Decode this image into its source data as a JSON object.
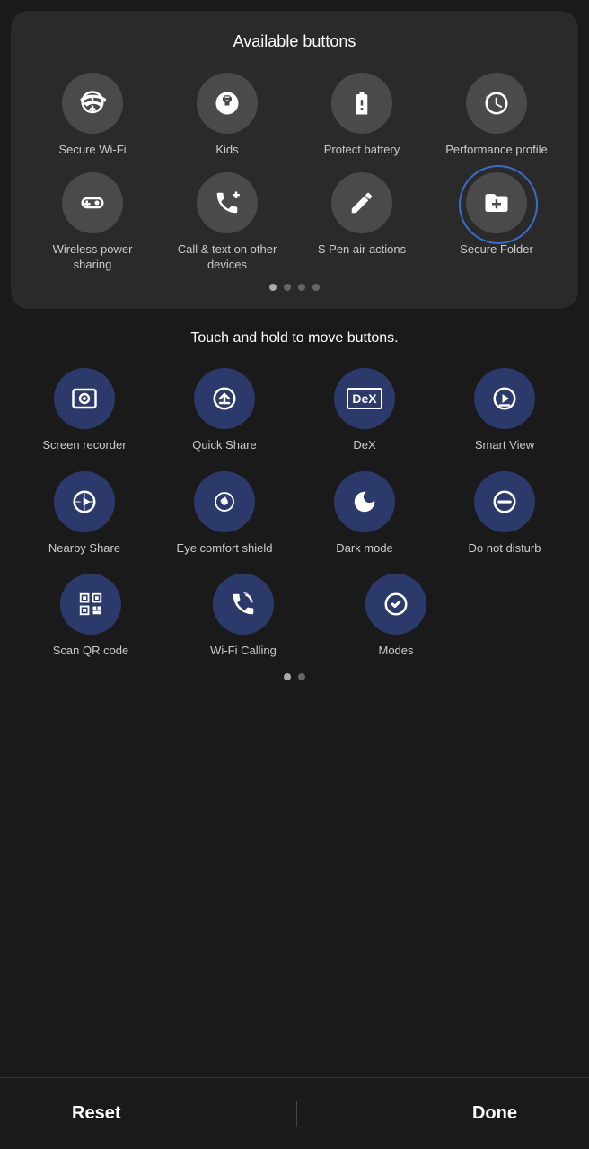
{
  "available": {
    "title": "Available buttons",
    "items_row1": [
      {
        "label": "Secure Wi-Fi",
        "icon": "wifi-shield"
      },
      {
        "label": "Kids",
        "icon": "kids"
      },
      {
        "label": "Protect battery",
        "icon": "battery-protect"
      },
      {
        "label": "Performance profile",
        "icon": "performance"
      }
    ],
    "items_row2": [
      {
        "label": "Wireless power sharing",
        "icon": "wireless-power"
      },
      {
        "label": "Call & text on other devices",
        "icon": "call-text"
      },
      {
        "label": "S Pen air actions",
        "icon": "spen"
      },
      {
        "label": "Secure Folder",
        "icon": "secure-folder",
        "circled": true
      }
    ],
    "dots": [
      true,
      false,
      false,
      false
    ]
  },
  "touch": {
    "title": "Touch and hold to move buttons.",
    "items_row1": [
      {
        "label": "Screen recorder",
        "icon": "screen-recorder"
      },
      {
        "label": "Quick Share",
        "icon": "quick-share"
      },
      {
        "label": "DeX",
        "icon": "dex"
      },
      {
        "label": "Smart View",
        "icon": "smart-view"
      }
    ],
    "items_row2": [
      {
        "label": "Nearby Share",
        "icon": "nearby-share"
      },
      {
        "label": "Eye comfort shield",
        "icon": "eye-comfort"
      },
      {
        "label": "Dark mode",
        "icon": "dark-mode"
      },
      {
        "label": "Do not disturb",
        "icon": "dnd"
      }
    ],
    "items_row3": [
      {
        "label": "Scan QR code",
        "icon": "scan-qr"
      },
      {
        "label": "Wi-Fi Calling",
        "icon": "wifi-calling"
      },
      {
        "label": "Modes",
        "icon": "modes"
      }
    ],
    "dots": [
      true,
      false
    ]
  },
  "bottom": {
    "reset_label": "Reset",
    "done_label": "Done"
  }
}
